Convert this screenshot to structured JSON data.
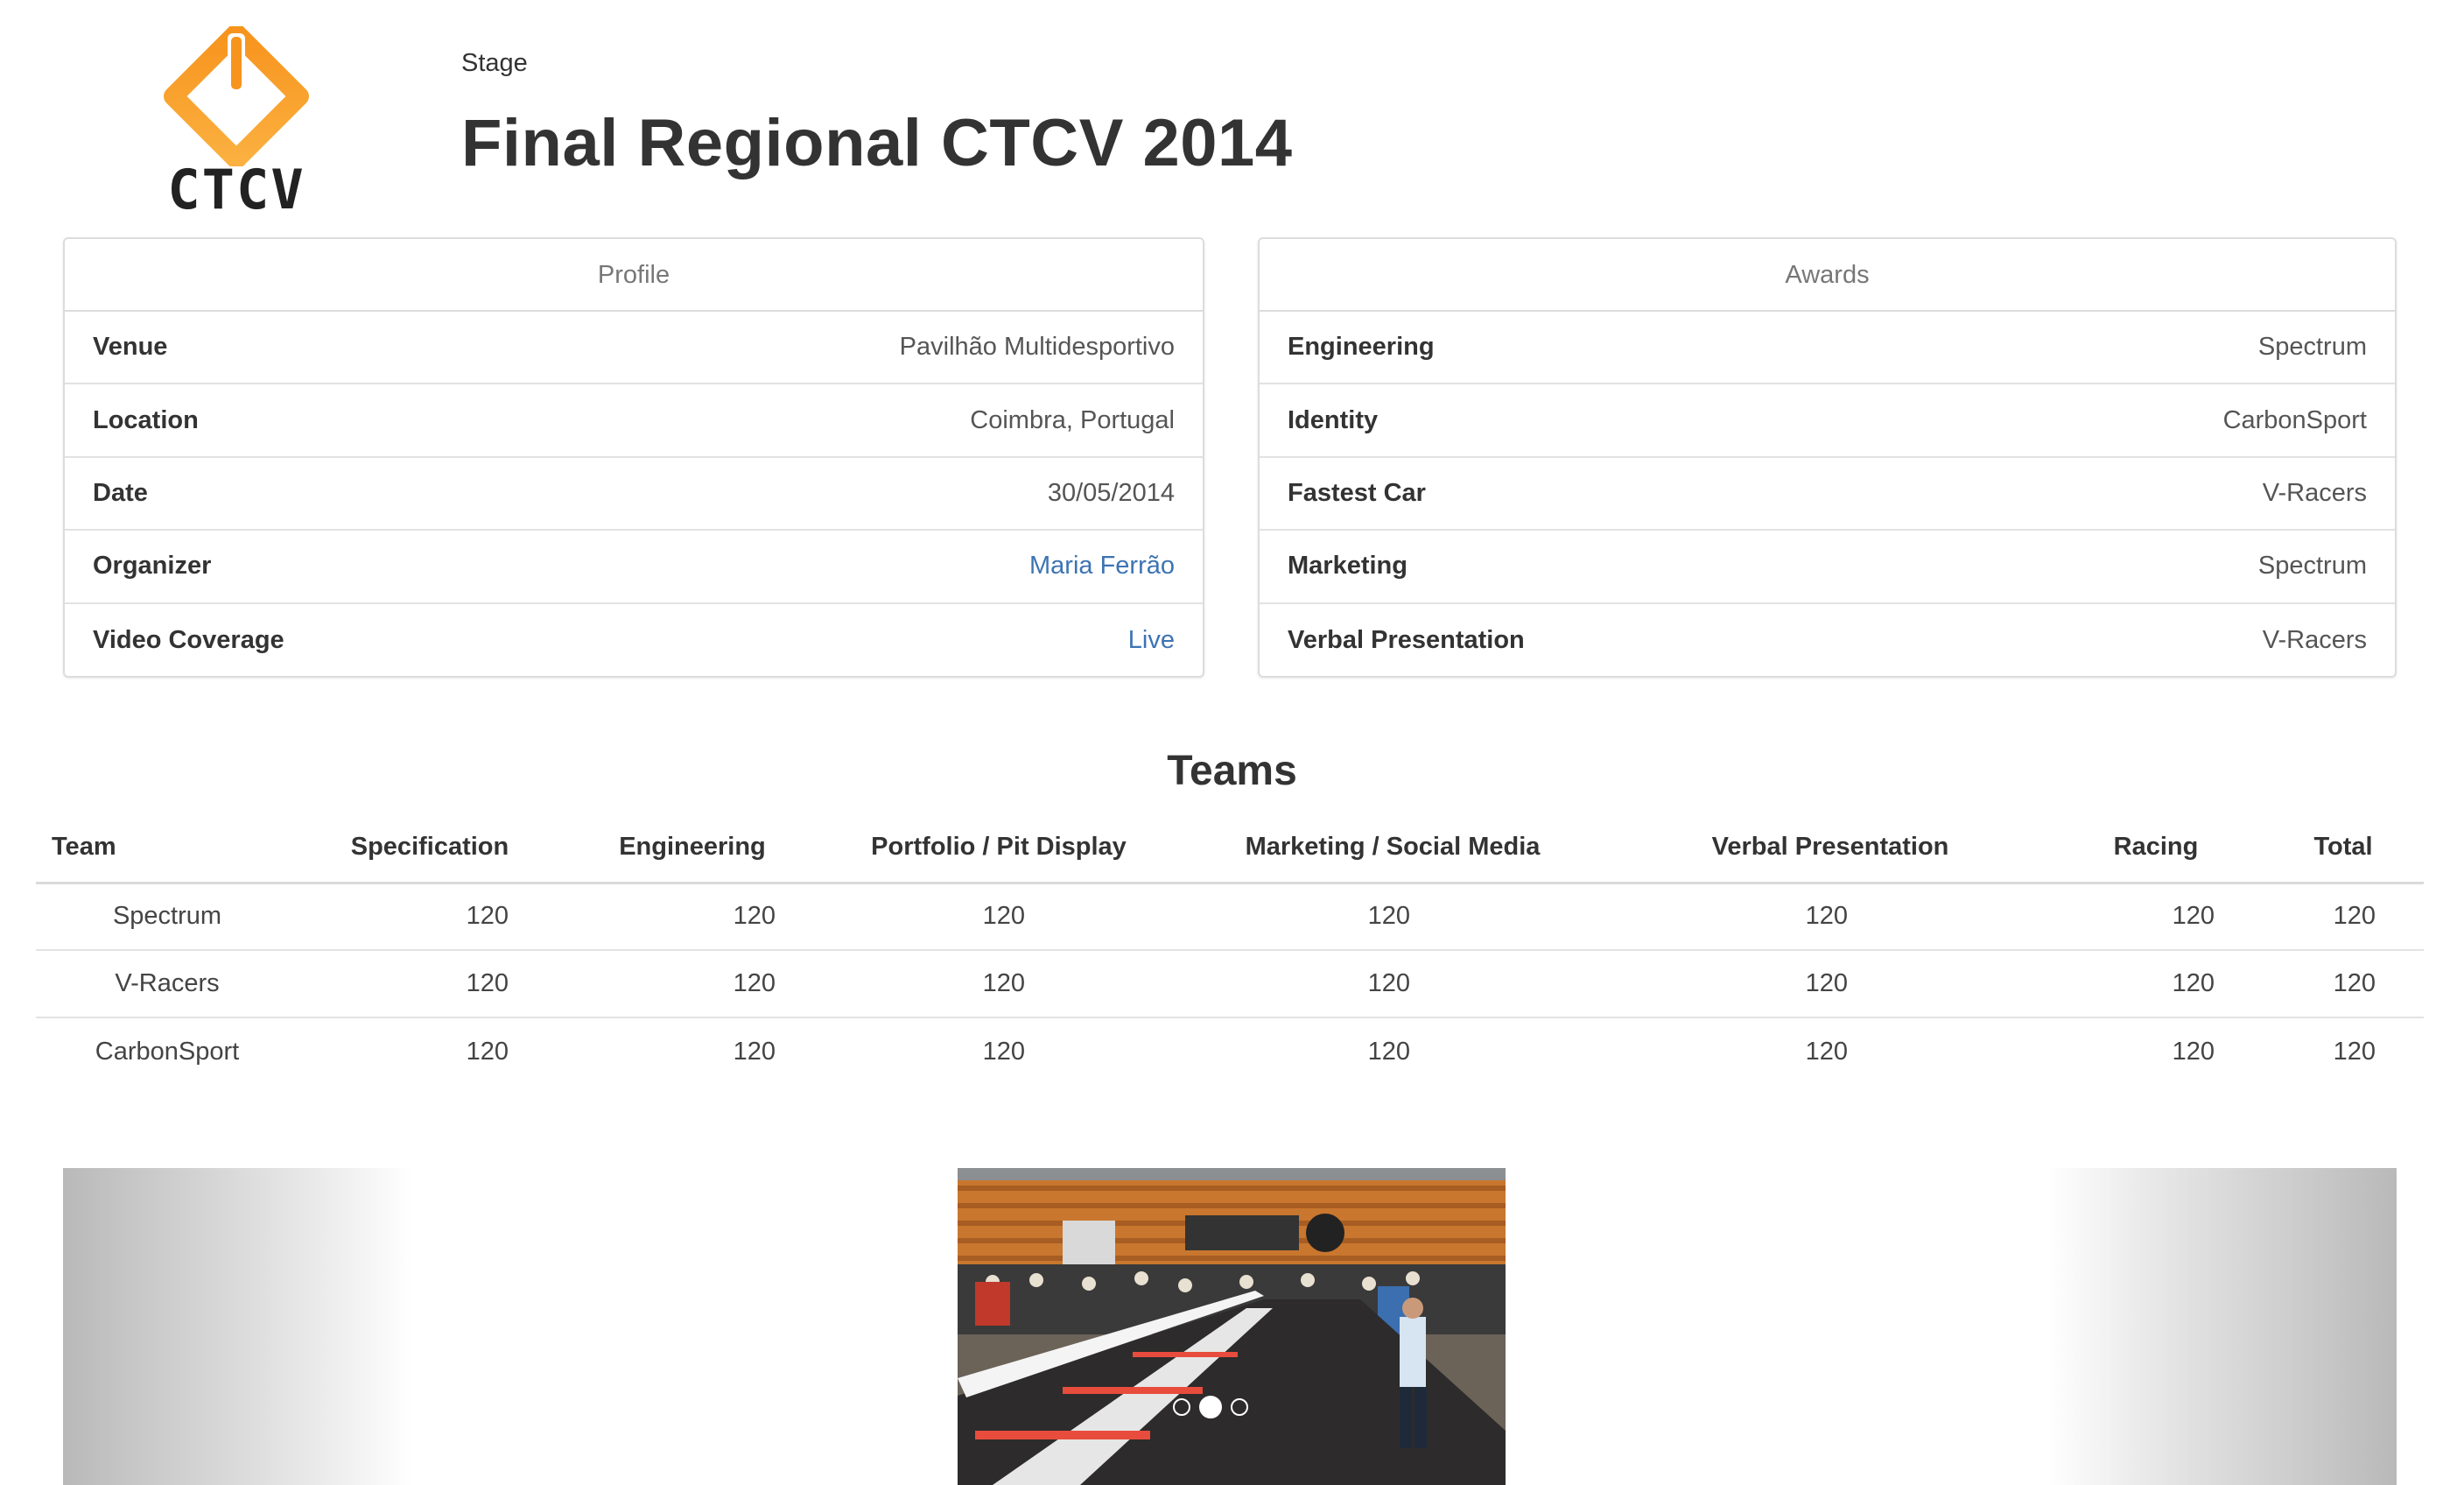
{
  "header": {
    "logo_text": "CTCV",
    "stage_label": "Stage",
    "title": "Final Regional CTCV 2014"
  },
  "profile": {
    "heading": "Profile",
    "rows": [
      {
        "label": "Venue",
        "value": "Pavilhão Multidesportivo"
      },
      {
        "label": "Location",
        "value": "Coimbra, Portugal"
      },
      {
        "label": "Date",
        "value": "30/05/2014"
      },
      {
        "label": "Organizer",
        "value": "Maria Ferrão"
      },
      {
        "label": "Video Coverage",
        "value": "Live"
      }
    ]
  },
  "awards": {
    "heading": "Awards",
    "rows": [
      {
        "label": "Engineering",
        "value": "Spectrum"
      },
      {
        "label": "Identity",
        "value": "CarbonSport"
      },
      {
        "label": "Fastest Car",
        "value": "V-Racers"
      },
      {
        "label": "Marketing",
        "value": "Spectrum"
      },
      {
        "label": "Verbal Presentation",
        "value": "V-Racers"
      }
    ]
  },
  "teams": {
    "title": "Teams",
    "columns": [
      "Team",
      "Specification",
      "Engineering",
      "Portfolio / Pit Display",
      "Marketing / Social Media",
      "Verbal Presentation",
      "Racing",
      "Total"
    ],
    "rows": [
      [
        "Spectrum",
        "120",
        "120",
        "120",
        "120",
        "120",
        "120",
        "120"
      ],
      [
        "V-Racers",
        "120",
        "120",
        "120",
        "120",
        "120",
        "120",
        "120"
      ],
      [
        "CarbonSport",
        "120",
        "120",
        "120",
        "120",
        "120",
        "120",
        "120"
      ]
    ]
  },
  "carousel": {
    "slide_count": 3,
    "active_index": 1
  },
  "colors": {
    "link": "#3d74b3",
    "logo_orange": "#f7941d",
    "logo_yellow": "#fbb040"
  }
}
